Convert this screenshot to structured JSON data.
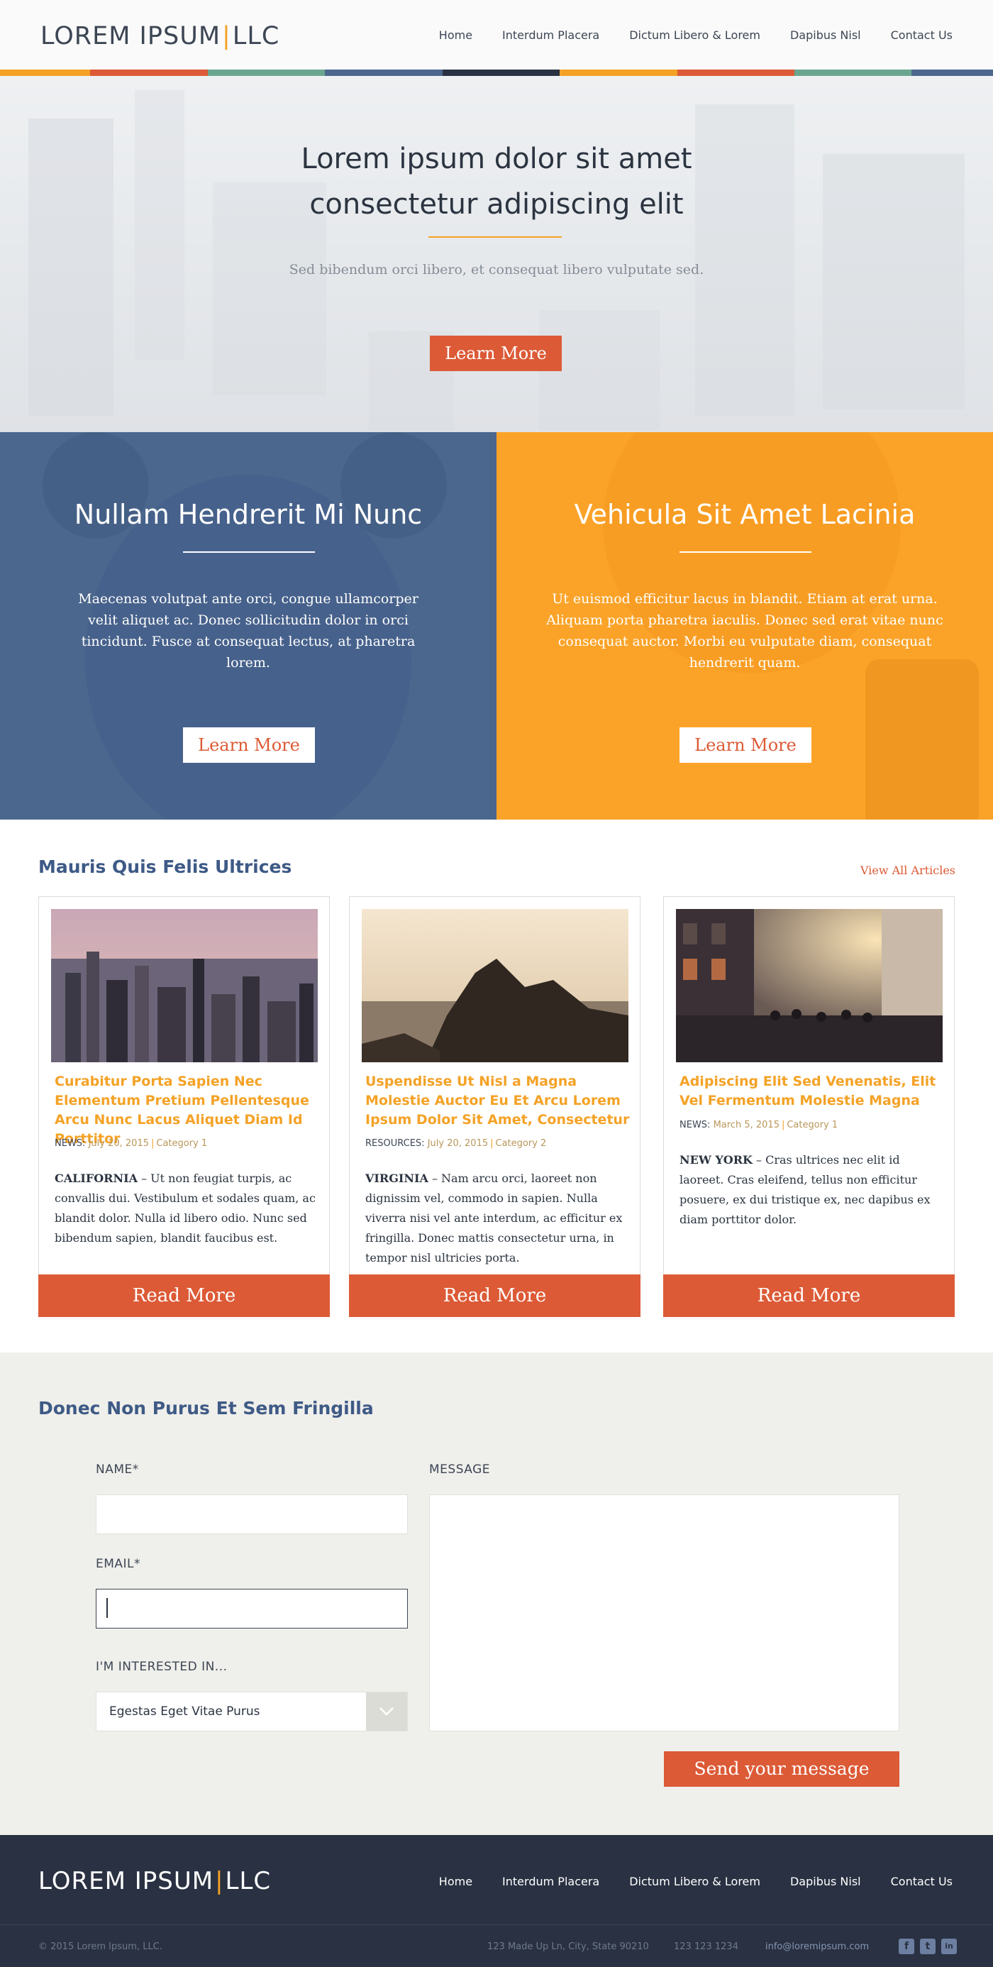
{
  "header": {
    "logo_left": "LOREM IPSUM",
    "logo_sep": "|",
    "logo_right": "LLC",
    "nav": [
      "Home",
      "Interdum Placera",
      "Dictum Libero & Lorem",
      "Dapibus Nisl",
      "Contact Us"
    ]
  },
  "colors": {
    "accent_orange": "#f4a226",
    "accent_red": "#dc5a36",
    "navy": "#3e5a86",
    "panel_blue": "#4c678d",
    "panel_orange": "#fba328",
    "footer": "#293142",
    "stripe": [
      "#f4a226",
      "#dc5a36",
      "#6aa68f",
      "#4c678d",
      "#293142",
      "#f4a226",
      "#dc5a36",
      "#6aa68f",
      "#4c678d"
    ]
  },
  "hero": {
    "title_line1": "Lorem ipsum dolor sit amet",
    "title_line2": "consectetur adipiscing elit",
    "subtitle": "Sed bibendum orci libero, et consequat libero vulputate sed.",
    "button": "Learn More"
  },
  "panels": [
    {
      "title": "Nullam Hendrerit Mi Nunc",
      "text": "Maecenas volutpat ante orci, congue ullamcorper velit aliquet ac. Donec sollicitudin dolor in orci tincidunt. Fusce at consequat lectus, at pharetra lorem.",
      "button": "Learn More"
    },
    {
      "title": "Vehicula Sit Amet Lacinia",
      "text": "Ut euismod efficitur lacus in blandit. Etiam at erat urna. Aliquam porta pharetra iaculis. Donec sed erat vitae nunc consequat auctor. Morbi eu vulputate diam, consequat hendrerit quam.",
      "button": "Learn More"
    }
  ],
  "articles": {
    "heading": "Mauris Quis Felis Ultrices",
    "view_all": "View All Articles",
    "cards": [
      {
        "title": "Curabitur Porta Sapien Nec Elementum Pretium Pellentesque Arcu Nunc  Lacus Aliquet Diam Id Porttitor",
        "type": "NEWS:",
        "date": "July 20, 2015",
        "sep": "|",
        "category": "Category 1",
        "location": "CALIFORNIA",
        "body": " – Ut non feugiat turpis, ac convallis dui. Vestibulum et sodales quam, ac blandit dolor. Nulla id libero odio. Nunc sed bibendum sapien, blandit faucibus est.",
        "button": "Read More"
      },
      {
        "title": "Uspendisse Ut Nisl a Magna Molestie Auctor Eu Et Arcu Lorem Ipsum Dolor Sit Amet, Consectetur",
        "type": "RESOURCES:",
        "date": "July 20, 2015",
        "sep": "|",
        "category": "Category 2",
        "location": "VIRGINIA",
        "body": " – Nam arcu orci, laoreet non dignissim vel, commodo in sapien. Nulla viverra nisi vel ante interdum, ac efficitur ex fringilla. Donec mattis consectetur urna, in tempor nisl ultricies porta.",
        "button": "Read More"
      },
      {
        "title": "Adipiscing Elit Sed Venenatis, Elit Vel Fermentum Molestie Magna",
        "type": "NEWS:",
        "date": "March 5, 2015",
        "sep": "|",
        "category": "Category 1",
        "location": "NEW YORK",
        "body": " – Cras ultrices nec elit id laoreet. Cras eleifend, tellus non efficitur posuere, ex dui tristique ex, nec dapibus ex diam porttitor dolor.",
        "button": "Read More"
      }
    ]
  },
  "contact": {
    "heading": "Donec Non Purus Et Sem Fringilla",
    "name_label": "NAME*",
    "name_value": "",
    "email_label": "EMAIL*",
    "email_value": "",
    "interest_label": "I'M INTERESTED IN...",
    "interest_value": "Egestas Eget Vitae Purus",
    "message_label": "MESSAGE",
    "message_value": "",
    "submit": "Send your message"
  },
  "footer": {
    "logo_left": "LOREM IPSUM",
    "logo_sep": "|",
    "logo_right": "LLC",
    "nav": [
      "Home",
      "Interdum Placera",
      "Dictum Libero & Lorem",
      "Dapibus Nisl",
      "Contact Us"
    ],
    "copyright": "© 2015 Lorem Ipsum, LLC.",
    "address": "123 Made Up Ln, City, State 90210",
    "phone": "123 123 1234",
    "email": "info@loremipsum.com",
    "social": [
      {
        "icon": "facebook-icon",
        "glyph": "f"
      },
      {
        "icon": "twitter-icon",
        "glyph": "t"
      },
      {
        "icon": "linkedin-icon",
        "glyph": "in"
      }
    ]
  }
}
